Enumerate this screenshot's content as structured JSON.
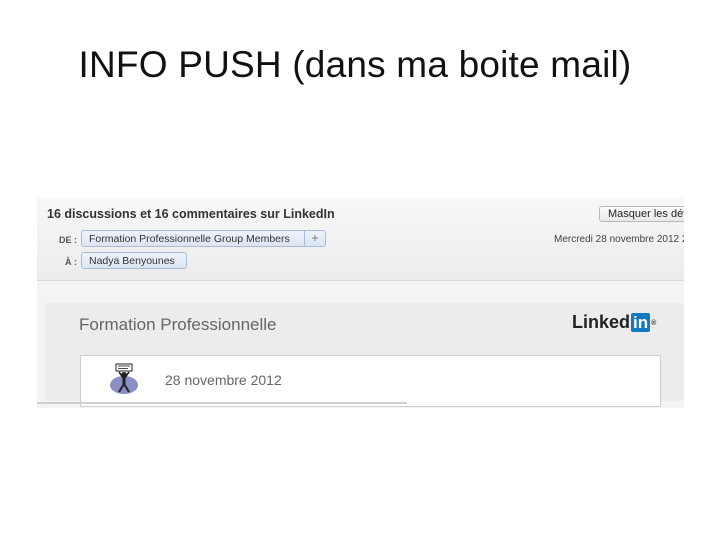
{
  "slide": {
    "title": "INFO PUSH  (dans ma boite mail)"
  },
  "email": {
    "subject": "16 discussions et 16 commentaires sur LinkedIn",
    "hide_button_label": "Masquer les dét",
    "from_label": "DE :",
    "from_value": "Formation Professionnelle Group Members",
    "to_label": "À :",
    "to_value": "Nadya Benyounes",
    "date": "Mercredi 28 novembre 2012 2"
  },
  "body": {
    "group_title": "Formation Professionnelle",
    "logo_text": "Linked",
    "logo_in": "in",
    "logo_reg": "®",
    "card_date": "28 novembre 2012"
  },
  "colors": {
    "linkedin_blue": "#1179c2",
    "chip_border": "#a9bcd6"
  },
  "icons": {
    "add": "plus-icon",
    "avatar": "group-avatar-icon"
  }
}
